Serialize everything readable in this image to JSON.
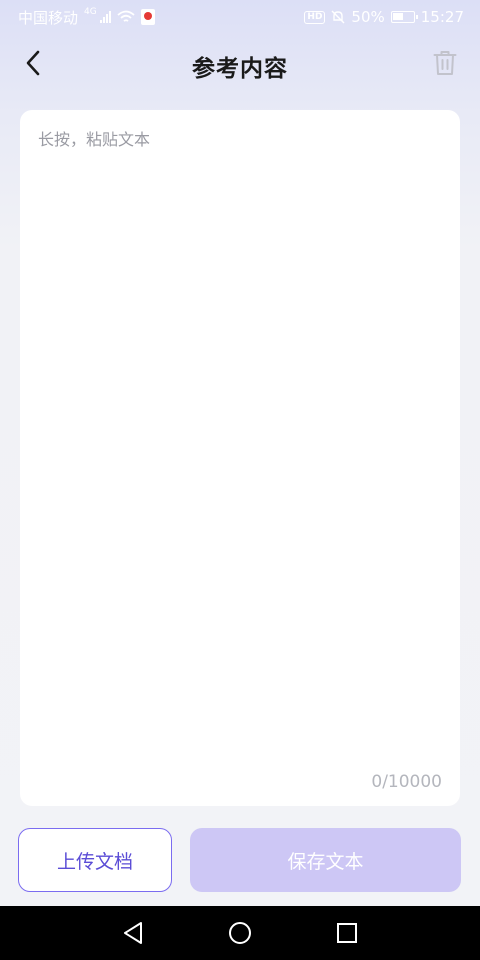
{
  "status_bar": {
    "carrier": "中国移动",
    "network_tag": "4G",
    "battery_percent": "50%",
    "time": "15:27"
  },
  "header": {
    "title": "参考内容"
  },
  "editor": {
    "placeholder": "长按，粘贴文本",
    "value": "",
    "char_count": "0/10000"
  },
  "actions": {
    "upload_label": "上传文档",
    "save_label": "保存文本"
  },
  "colors": {
    "accent": "#7b6cf0",
    "save_disabled": "#cdc7f5"
  },
  "icons": {
    "back": "chevron-left-icon",
    "delete": "trash-icon",
    "nav_back": "triangle-back-icon",
    "nav_home": "circle-home-icon",
    "nav_recents": "square-recents-icon"
  }
}
